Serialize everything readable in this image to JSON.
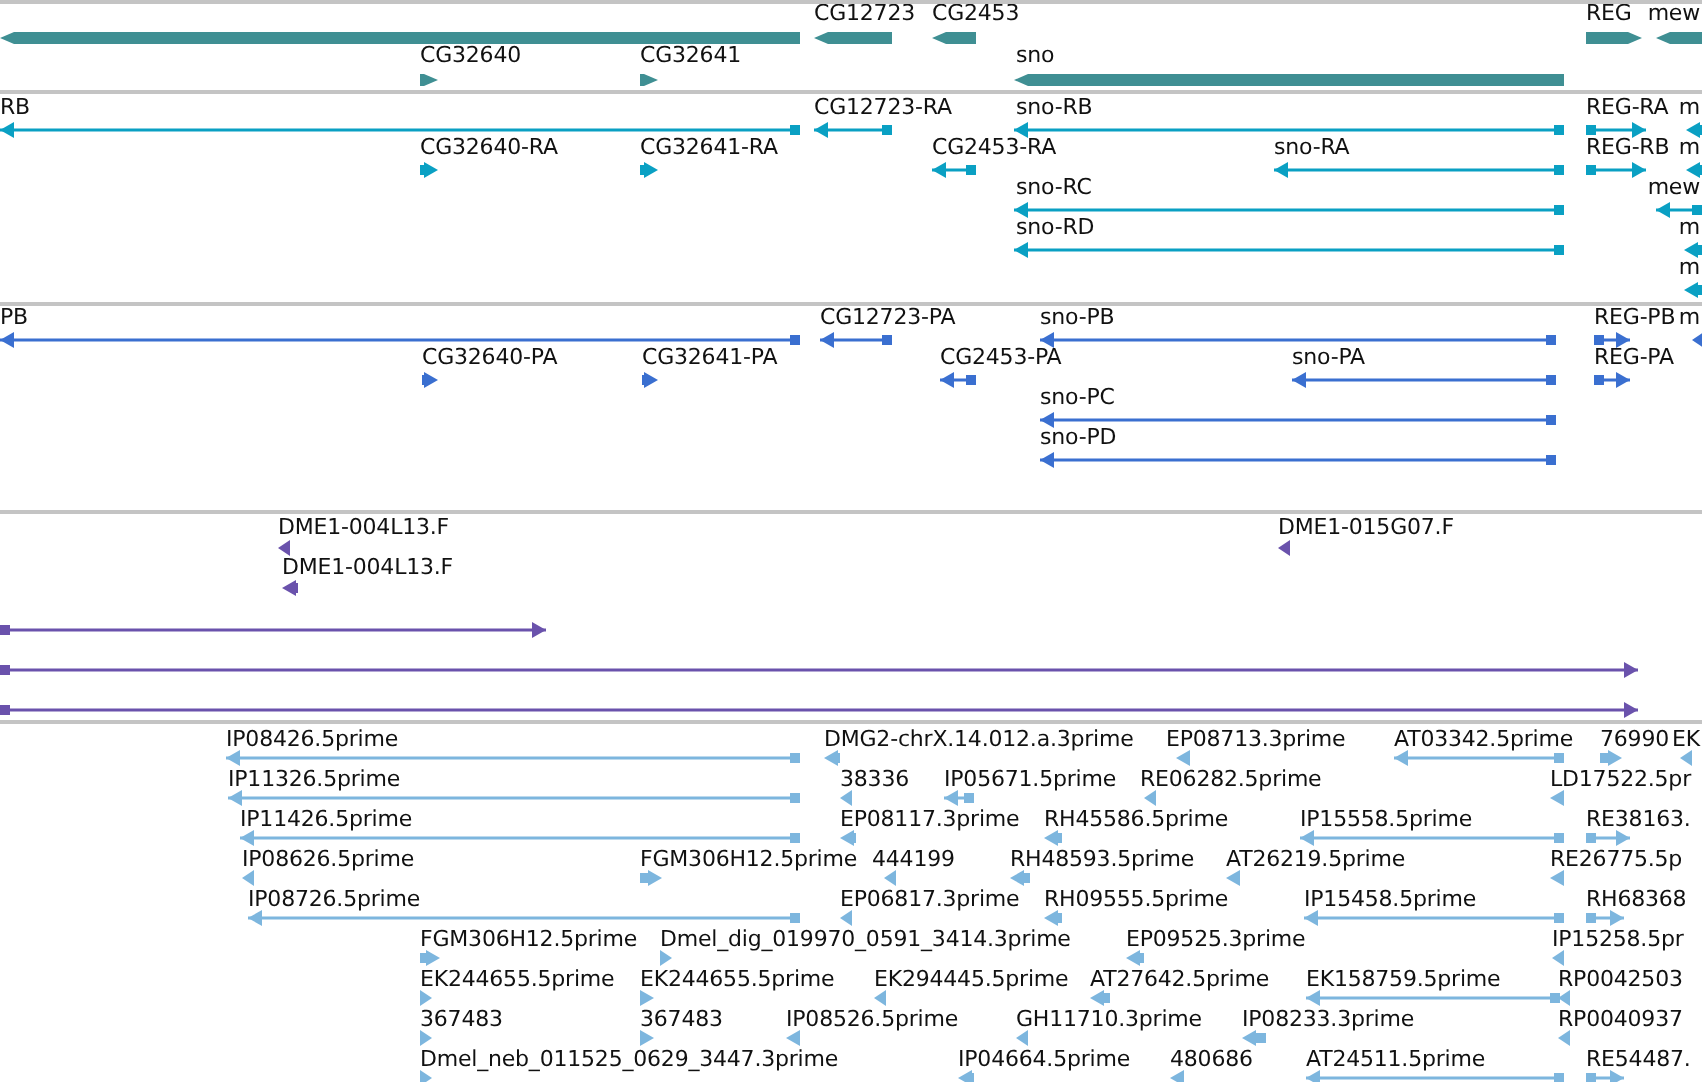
{
  "tracks": [
    {
      "kind": "bar",
      "color": "#3f8f93",
      "features": [
        {
          "kind": "minus"
        },
        {
          "label": "CG12723",
          "kind": "minus"
        },
        {
          "label": "CG2453",
          "kind": "minus"
        },
        {
          "label": "REG",
          "kind": "plus"
        },
        {
          "label": "mew",
          "kind": "minus"
        },
        {
          "label": "CG32640",
          "kind": "plus"
        },
        {
          "label": "CG32641",
          "kind": "plus"
        },
        {
          "label": "sno",
          "kind": "minus"
        }
      ]
    },
    {
      "kind": "line",
      "color": "#0aa0c3",
      "features": [
        {
          "label": "RB",
          "kind": "minus"
        },
        {
          "label": "CG12723-RA",
          "kind": "minus"
        },
        {
          "label": "sno-RB",
          "kind": "minus"
        },
        {
          "label": "REG-RA",
          "kind": "plus"
        },
        {
          "label": "m",
          "kind": "minus"
        },
        {
          "label": "CG32640-RA",
          "kind": "plus"
        },
        {
          "label": "CG32641-RA",
          "kind": "plus"
        },
        {
          "label": "CG2453-RA",
          "kind": "minus"
        },
        {
          "label": "sno-RA",
          "kind": "minus"
        },
        {
          "label": "REG-RB",
          "kind": "plus"
        },
        {
          "label": "m",
          "kind": "minus"
        },
        {
          "label": "sno-RC",
          "kind": "minus"
        },
        {
          "label": "mew",
          "kind": "minus"
        },
        {
          "label": "sno-RD",
          "kind": "minus"
        },
        {
          "label": "m",
          "kind": "minus"
        },
        {
          "label": "m",
          "kind": "minus"
        }
      ]
    },
    {
      "kind": "line",
      "color": "#3a6fd0",
      "features": [
        {
          "label": "PB",
          "kind": "minus"
        },
        {
          "label": "CG12723-PA",
          "kind": "minus"
        },
        {
          "label": "sno-PB",
          "kind": "minus"
        },
        {
          "label": "REG-PB",
          "kind": "plus"
        },
        {
          "label": "m",
          "kind": "minus"
        },
        {
          "label": "CG32640-PA",
          "kind": "plus"
        },
        {
          "label": "CG32641-PA",
          "kind": "plus"
        },
        {
          "label": "CG2453-PA",
          "kind": "minus"
        },
        {
          "label": "sno-PA",
          "kind": "minus"
        },
        {
          "label": "REG-PA",
          "kind": "plus"
        },
        {
          "label": "sno-PC",
          "kind": "minus"
        },
        {
          "label": "sno-PD",
          "kind": "minus"
        }
      ]
    },
    {
      "kind": "line",
      "color": "#6a52ac",
      "features": [
        {
          "label": "DME1-004L13.F",
          "kind": "minus"
        },
        {
          "label": "DME1-004L13.F",
          "kind": "minus"
        },
        {
          "label": "DME1-015G07.F",
          "kind": "minus"
        },
        {
          "kind": "plus"
        },
        {
          "kind": "plus"
        },
        {
          "kind": "plus"
        }
      ]
    },
    {
      "kind": "line",
      "color": "#7db6de",
      "features": [
        {
          "label": "IP08426.5prime",
          "kind": "minus"
        },
        {
          "label": "DMG2-chrX.14.012.a.3prime",
          "kind": "minus"
        },
        {
          "label": "EP08713.3prime",
          "kind": "minus"
        },
        {
          "label": "AT03342.5prime",
          "kind": "minus"
        },
        {
          "label": "76990",
          "kind": "plus"
        },
        {
          "label": "EK",
          "kind": "minus"
        },
        {
          "label": "IP11326.5prime",
          "kind": "minus"
        },
        {
          "label": "38336",
          "kind": "minus"
        },
        {
          "label": "IP05671.5prime",
          "kind": "minus"
        },
        {
          "label": "RE06282.5prime",
          "kind": "minus"
        },
        {
          "label": "LD17522.5pr",
          "kind": "minus"
        },
        {
          "label": "IP11426.5prime",
          "kind": "minus"
        },
        {
          "label": "EP08117.3prime",
          "kind": "minus"
        },
        {
          "label": "RH45586.5prime",
          "kind": "minus"
        },
        {
          "label": "IP15558.5prime",
          "kind": "minus"
        },
        {
          "label": "RE38163.",
          "kind": "plus"
        },
        {
          "label": "IP08626.5prime",
          "kind": "minus"
        },
        {
          "label": "FGM306H12.5prime",
          "kind": "plus"
        },
        {
          "label": "444199",
          "kind": "minus"
        },
        {
          "label": "RH48593.5prime",
          "kind": "minus"
        },
        {
          "label": "AT26219.5prime",
          "kind": "minus"
        },
        {
          "label": "RE26775.5p",
          "kind": "minus"
        },
        {
          "label": "IP08726.5prime",
          "kind": "minus"
        },
        {
          "label": "EP06817.3prime",
          "kind": "minus"
        },
        {
          "label": "RH09555.5prime",
          "kind": "minus"
        },
        {
          "label": "IP15458.5prime",
          "kind": "minus"
        },
        {
          "label": "RH68368",
          "kind": "plus"
        },
        {
          "label": "FGM306H12.5prime",
          "kind": "plus"
        },
        {
          "label": "Dmel_dig_019970_0591_3414.3prime",
          "kind": "plus"
        },
        {
          "label": "EP09525.3prime",
          "kind": "minus"
        },
        {
          "label": "IP15258.5pr",
          "kind": "minus"
        },
        {
          "label": "EK244655.5prime",
          "kind": "plus"
        },
        {
          "label": "EK244655.5prime",
          "kind": "plus"
        },
        {
          "label": "EK294445.5prime",
          "kind": "minus"
        },
        {
          "label": "AT27642.5prime",
          "kind": "minus"
        },
        {
          "label": "EK158759.5prime",
          "kind": "minus"
        },
        {
          "label": "RP0042503",
          "kind": "minus"
        },
        {
          "label": "367483",
          "kind": "plus"
        },
        {
          "label": "367483",
          "kind": "plus"
        },
        {
          "label": "IP08526.5prime",
          "kind": "minus"
        },
        {
          "label": "GH11710.3prime",
          "kind": "minus"
        },
        {
          "label": "IP08233.3prime",
          "kind": "minus"
        },
        {
          "label": "RP0040937",
          "kind": "minus"
        },
        {
          "label": "Dmel_neb_011525_0629_3447.3prime",
          "kind": "plus"
        },
        {
          "label": "IP04664.5prime",
          "kind": "minus"
        },
        {
          "label": "480686",
          "kind": "minus"
        },
        {
          "label": "AT24511.5prime",
          "kind": "minus"
        },
        {
          "label": "RE54487.",
          "kind": "plus"
        }
      ]
    }
  ]
}
